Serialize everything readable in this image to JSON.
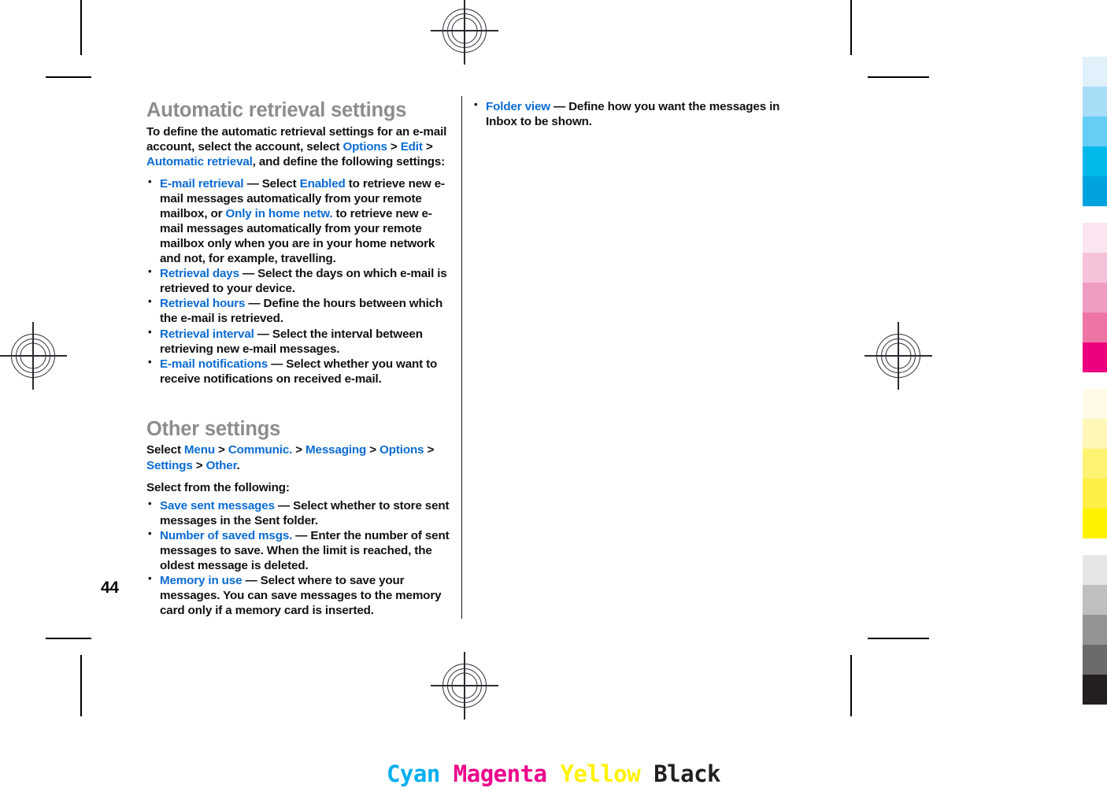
{
  "page": {
    "number": "44",
    "left_column": {
      "heading_1": "Automatic retrieval settings",
      "intro_1": {
        "t1": "To define the automatic retrieval settings for an e-mail account, select the account, select ",
        "ui1": "Options",
        "s1": " > ",
        "ui2": "Edit",
        "s2": " > ",
        "ui3": "Automatic retrieval",
        "t2": ", and define the following settings:"
      },
      "bullets_1": [
        {
          "term": "E-mail retrieval",
          "d1": " — Select ",
          "ui1": "Enabled",
          "d2": " to retrieve new e-mail messages automatically from your remote mailbox, or ",
          "ui2": "Only in home netw.",
          "d3": " to retrieve new e-mail messages automatically from your remote mailbox only when you are in your home network and not, for example, travelling."
        },
        {
          "term": "Retrieval days",
          "d1": " — Select the days on which e-mail is retrieved to your device."
        },
        {
          "term": "Retrieval hours",
          "d1": " — Define the hours between which the e-mail is retrieved."
        },
        {
          "term": "Retrieval interval",
          "d1": " — Select the interval between retrieving new e-mail messages."
        },
        {
          "term": "E-mail notifications",
          "d1": " — Select whether you want to receive notifications on received e-mail."
        }
      ],
      "heading_2": "Other settings",
      "path_2": {
        "t1": "Select ",
        "ui1": "Menu",
        "s1": " > ",
        "ui2": "Communic.",
        "s2": " > ",
        "ui3": "Messaging",
        "s3": " > ",
        "ui4": "Options",
        "s4": " > ",
        "ui5": "Settings",
        "s5": " > ",
        "ui6": "Other",
        "t2": "."
      },
      "intro_2": "Select from the following:",
      "bullets_2": [
        {
          "term": "Save sent messages",
          "d1": "  — Select whether to store sent messages in the Sent folder."
        },
        {
          "term": "Number of saved msgs.",
          "d1": "  — Enter the number of sent messages to save. When the limit is reached, the oldest message is deleted."
        },
        {
          "term": "Memory in use",
          "d1": "  — Select where to save your messages. You can save messages to the memory card only if a memory card is inserted."
        }
      ]
    },
    "right_column": {
      "bullets": [
        {
          "term": "Folder view",
          "d1": "  — Define how you want the messages in Inbox to be shown."
        }
      ]
    }
  },
  "print_marks": {
    "footer_labels": [
      {
        "text": "Cyan",
        "color": "#00aeef"
      },
      {
        "text": "Magenta",
        "color": "#ec008c"
      },
      {
        "text": "Yellow",
        "color": "#fff200"
      },
      {
        "text": "Black",
        "color": "#231f20"
      }
    ],
    "swatches": {
      "cyan": [
        "#e1f1fc",
        "#a8ddf8",
        "#66cdf4",
        "#00b8ea",
        "#00a3e0"
      ],
      "magenta": [
        "#fbe5f0",
        "#f5c2da",
        "#f09dc3",
        "#ee74a6",
        "#ec0080"
      ],
      "yellow": [
        "#fffbe8",
        "#fff7b8",
        "#fff373",
        "#ffee45",
        "#fff200"
      ],
      "black": [
        "#e6e6e6",
        "#bfbfbf",
        "#949494",
        "#6b6b6b",
        "#231f20"
      ]
    }
  }
}
